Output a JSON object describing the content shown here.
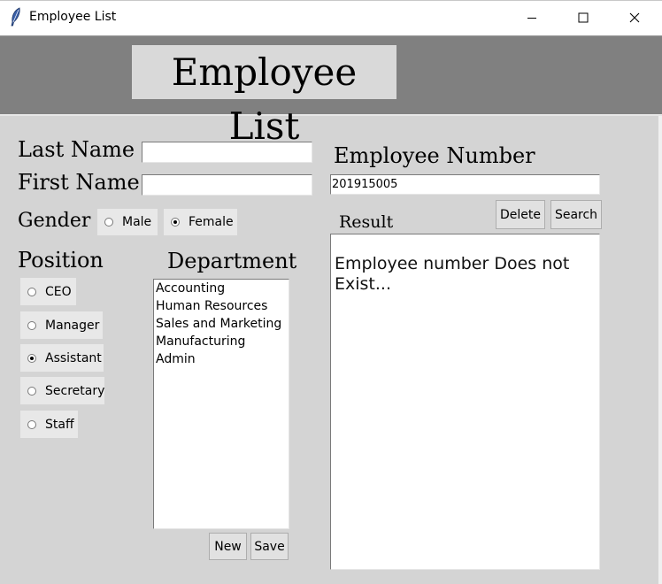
{
  "window": {
    "title": "Employee List",
    "icon": "feather-icon",
    "controls": [
      "minimize-icon",
      "maximize-icon",
      "close-icon"
    ]
  },
  "header": {
    "title": "Employee List"
  },
  "form": {
    "last_name_label": "Last Name",
    "last_name_value": "",
    "first_name_label": "First Name",
    "first_name_value": "",
    "gender_label": "Gender",
    "gender_options": [
      {
        "label": "Male",
        "selected": false
      },
      {
        "label": "Female",
        "selected": true
      }
    ],
    "position_label": "Position",
    "position_options": [
      {
        "label": "CEO",
        "selected": false
      },
      {
        "label": "Manager",
        "selected": false
      },
      {
        "label": "Assistant",
        "selected": true
      },
      {
        "label": "Secretary",
        "selected": false
      },
      {
        "label": "Staff",
        "selected": false
      }
    ],
    "department_label": "Department",
    "departments": [
      "Accounting",
      "Human Resources",
      "Sales and Marketing",
      "Manufacturing",
      "Admin"
    ],
    "new_button": "New",
    "save_button": "Save"
  },
  "lookup": {
    "employee_number_label": "Employee Number",
    "employee_number_value": "201915005",
    "delete_button": "Delete",
    "search_button": "Search",
    "result_label": "Result",
    "result_text": "Employee number Does not Exist..."
  },
  "colors": {
    "background": "#d4d4d4",
    "header_band": "#808080",
    "title_bg": "#d9d9d9",
    "button_bg": "#e1e1e1"
  }
}
